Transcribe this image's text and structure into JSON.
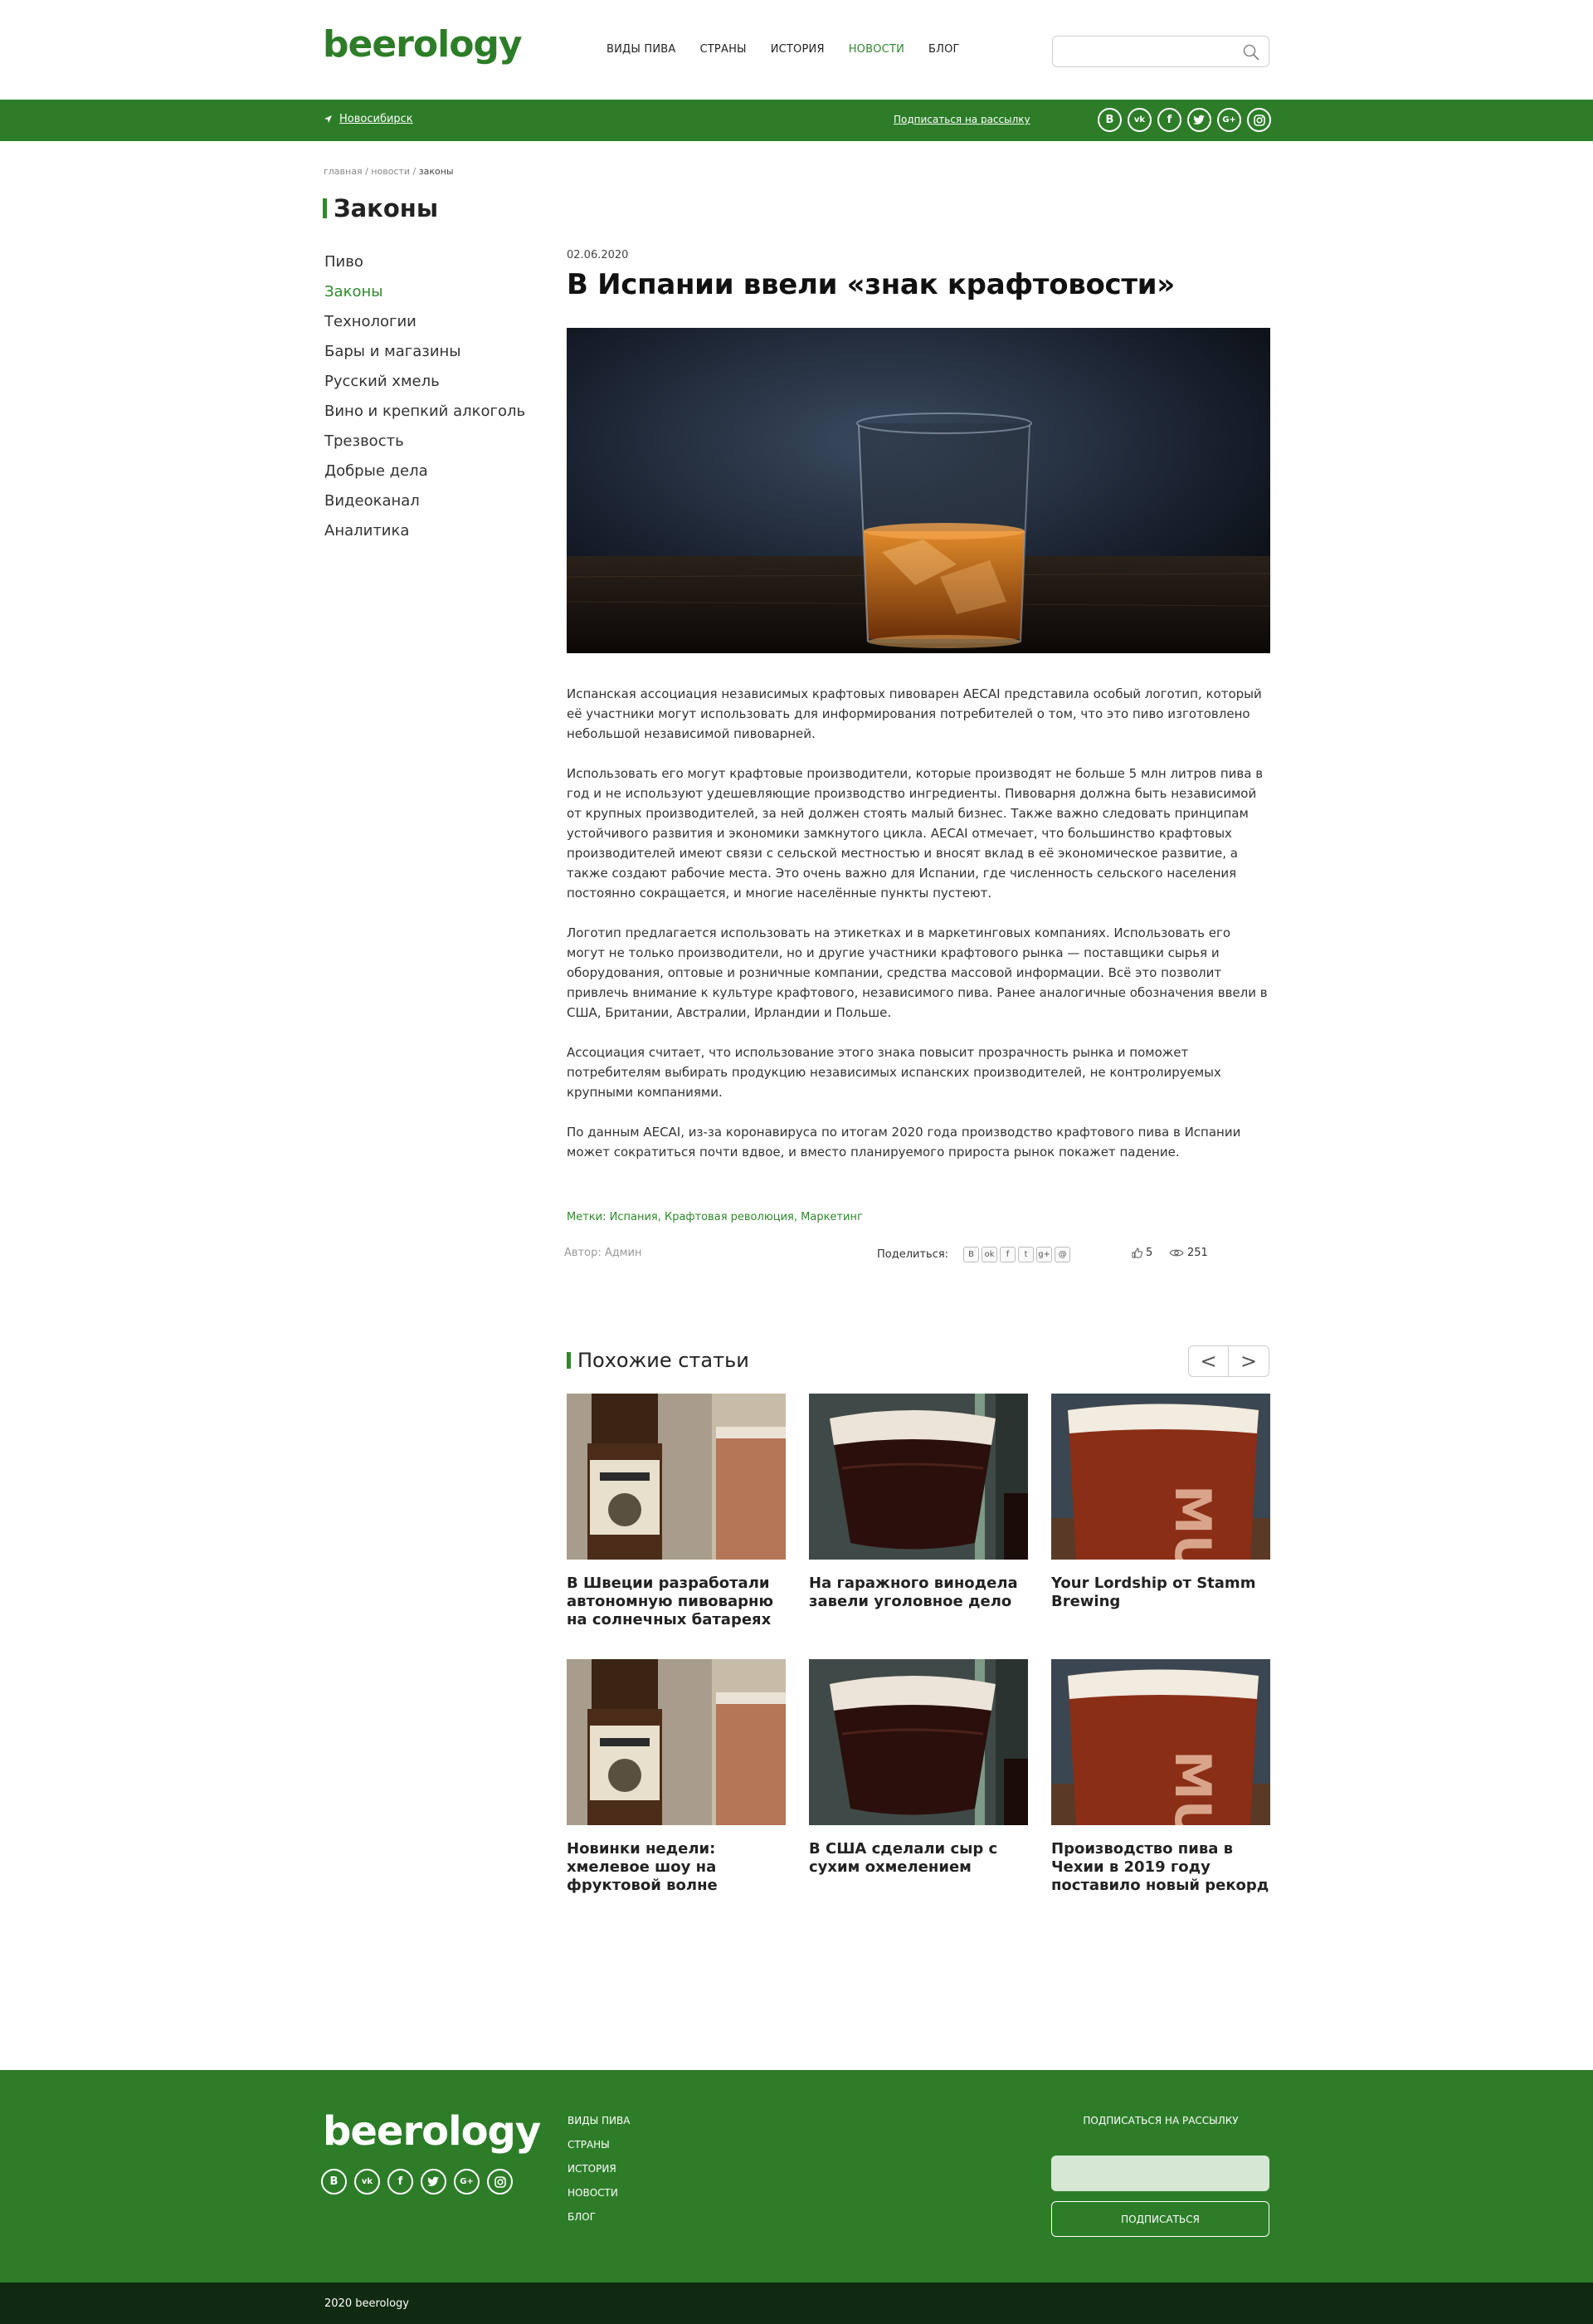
{
  "header": {
    "logo": "beerology",
    "nav": [
      {
        "label": "ВИДЫ ПИВА",
        "active": false
      },
      {
        "label": "СТРАНЫ",
        "active": false
      },
      {
        "label": "ИСТОРИЯ",
        "active": false
      },
      {
        "label": "НОВОСТИ",
        "active": true
      },
      {
        "label": "БЛОГ",
        "active": false
      }
    ],
    "search_placeholder": "",
    "search_icon": "magnifier-icon"
  },
  "topbar": {
    "city": "Новосибирск",
    "subscribe": "Подписаться на рассылку",
    "social": [
      "B",
      "vk",
      "f",
      "twitter",
      "G+",
      "instagram"
    ]
  },
  "breadcrumb": {
    "home": "главная",
    "news": "новости",
    "current": "законы",
    "separator": " / "
  },
  "section": {
    "title": "Законы"
  },
  "sidebar": {
    "items": [
      {
        "label": "Пиво",
        "active": false
      },
      {
        "label": "Законы",
        "active": true
      },
      {
        "label": "Технологии",
        "active": false
      },
      {
        "label": "Бары и магазины",
        "active": false
      },
      {
        "label": "Русский хмель",
        "active": false
      },
      {
        "label": "Вино и крепкий алкоголь",
        "active": false
      },
      {
        "label": "Трезвость",
        "active": false
      },
      {
        "label": "Добрые дела",
        "active": false
      },
      {
        "label": "Видеоканал",
        "active": false
      },
      {
        "label": "Аналитика",
        "active": false
      }
    ]
  },
  "article": {
    "date": "02.06.2020",
    "title": "В Испании ввели «знак крафтовости»",
    "paragraphs": [
      "Испанская ассоциация независимых крафтовых пивоварен AECAI представила особый логотип, который её участники могут использовать для информирования потребителей о том, что это пиво изготовлено небольшой независимой пивоварней.",
      "Использовать его могут крафтовые производители, которые производят не больше 5 млн литров пива в год и не используют удешевляющие производство ингредиенты. Пивоварня должна быть независимой от крупных производителей, за ней должен стоять малый бизнес. Также важно следовать принципам устойчивого развития и экономики замкнутого цикла. AECAI отмечает, что большинство крафтовых производителей имеют связи с сельской местностью и вносят вклад в её экономическое развитие, а также создают рабочие места. Это очень важно для Испании, где численность сельского населения постоянно сокращается, и многие населённые пункты пустеют.",
      "Логотип предлагается использовать на этикетках и в маркетинговых компаниях. Использовать его могут не только производители, но и другие участники крафтового рынка — поставщики сырья и оборудования, оптовые и розничные компании, средства массовой информации. Всё это позволит привлечь внимание к культуре крафтового, независимого пива. Ранее аналогичные обозначения ввели в США, Британии, Австралии, Ирландии и Польше.",
      "Ассоциация считает, что использование этого знака повысит прозрачность рынка и поможет потребителям выбирать продукцию независимых испанских производителей, не контролируемых крупными компаниями.",
      "По данным AECAI, из-за коронавируса по итогам 2020 года производство крафтового пива в Испании может сократиться почти вдвое, и вместо планируемого прироста рынок покажет падение."
    ],
    "tags_label": "Метки: Испания, Крафтовая революция, Маркетинг",
    "author": "Автор: Админ",
    "share_label": "Поделиться:",
    "share_icons": [
      "B",
      "ok",
      "f",
      "twitter",
      "g+",
      "mail"
    ],
    "likes": "5",
    "views": "251"
  },
  "related": {
    "title": "Похожие статьи",
    "prev": "<",
    "next": ">",
    "cards": [
      {
        "title": "В Швеции разработали автономную пивоварню на солнечных батареях",
        "image": "bottle-and-glass"
      },
      {
        "title": "На гаражного винодела завели уголовное дело",
        "image": "dark-beer-glass"
      },
      {
        "title": "Your Lordship от Stamm Brewing",
        "image": "amber-beer-glass"
      },
      {
        "title": "Новинки недели: хмелевое шоу на фруктовой волне",
        "image": "bottle-and-glass"
      },
      {
        "title": "В США сделали сыр с сухим охмелением",
        "image": "dark-beer-glass"
      },
      {
        "title": "Производство пива в Чехии в 2019 году поставило новый рекорд",
        "image": "amber-beer-glass"
      }
    ]
  },
  "footer": {
    "logo": "beerology",
    "nav": [
      "ВИДЫ ПИВА",
      "СТРАНЫ",
      "ИСТОРИЯ",
      "НОВОСТИ",
      "БЛОГ"
    ],
    "subscribe_title": "ПОДПИСАТЬСЯ НА РАССЫЛКУ",
    "email_placeholder": "",
    "subscribe_button": "ПОДПИСАТЬСЯ",
    "copyright": "2020 beerology"
  },
  "colors": {
    "brand_green": "#2d7d28",
    "link_green": "#2d8a2a",
    "bottom_bar": "#0f2a10"
  }
}
